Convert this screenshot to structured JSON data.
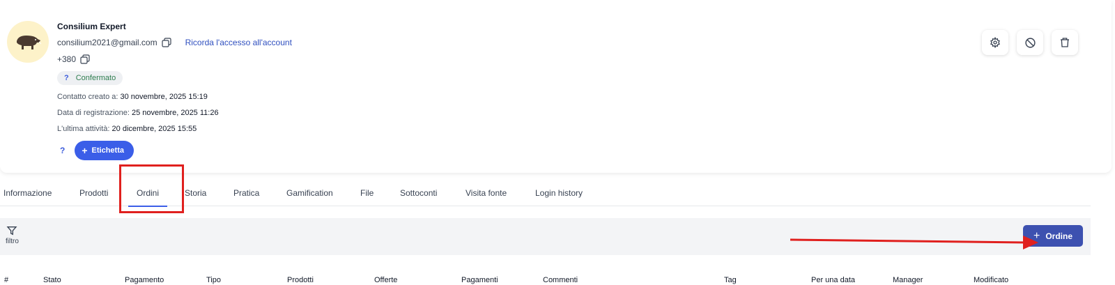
{
  "contact": {
    "name": "Consilium Expert",
    "email": "consilium2021@gmail.com",
    "remember_link": "Ricorda l'accesso all'account",
    "phone": "+380",
    "status_badge": "Confermato",
    "status_icon": "?",
    "created_label": "Contatto creato a:",
    "created_value": "30 novembre, 2025 15:19",
    "registered_label": "Data di registrazione:",
    "registered_value": "25 novembre, 2025 11:26",
    "last_activity_label": "L'ultima attività:",
    "last_activity_value": "20 dicembre, 2025 15:55",
    "tag_help": "?",
    "tag_button": "Etichetta",
    "avatar_icon": "boar-icon"
  },
  "actions": {
    "settings_icon": "gear-icon",
    "block_icon": "block-icon",
    "delete_icon": "trash-icon"
  },
  "tabs": [
    {
      "label": "Informazione"
    },
    {
      "label": "Prodotti"
    },
    {
      "label": "Ordini",
      "active": true
    },
    {
      "label": "Storia"
    },
    {
      "label": "Pratica"
    },
    {
      "label": "Gamification"
    },
    {
      "label": "File"
    },
    {
      "label": "Sottoconti"
    },
    {
      "label": "Visita fonte"
    },
    {
      "label": "Login history"
    }
  ],
  "toolbar": {
    "filter_label": "filtro",
    "new_order_label": "Ordine"
  },
  "table": {
    "headers": [
      "#",
      "Stato",
      "Pagamento",
      "Tipo",
      "Prodotti",
      "Offerte",
      "Pagamenti",
      "Commenti",
      "Tag",
      "Per una data",
      "Manager",
      "Modificato"
    ]
  },
  "colors": {
    "accent": "#3b5ee8",
    "order_button": "#3d51b0",
    "annotation": "#e0201e",
    "badge_text": "#2e7d4f"
  }
}
